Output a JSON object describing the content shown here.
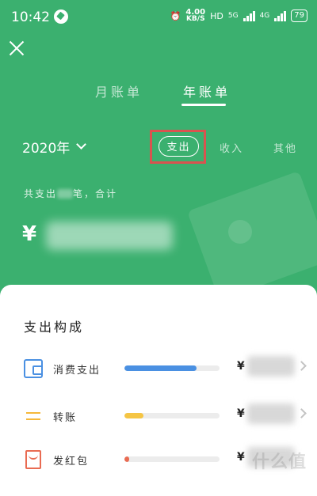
{
  "status_bar": {
    "time": "10:42",
    "speed_value": "4.00",
    "speed_unit": "KB/S",
    "hd": "HD",
    "net1": "5G",
    "net2": "4G",
    "battery": "79"
  },
  "tabs": [
    {
      "label": "月账单",
      "active": false
    },
    {
      "label": "年账单",
      "active": true
    }
  ],
  "year_select": {
    "value": "2020年"
  },
  "filters": {
    "expense": "支出",
    "income": "收入",
    "other": "其他"
  },
  "summary": {
    "prefix": "共支出",
    "suffix": "笔，合计",
    "currency": "¥"
  },
  "breakdown": {
    "title": "支出构成",
    "items": [
      {
        "label": "消费支出",
        "currency": "¥",
        "progress_fraction": 0.76,
        "color": "#4a90e2",
        "icon": "wallet-icon"
      },
      {
        "label": "转账",
        "currency": "¥",
        "progress_fraction": 0.2,
        "color": "#f5c544",
        "icon": "transfer-icon"
      },
      {
        "label": "发红包",
        "currency": "¥",
        "progress_fraction": 0.05,
        "color": "#e96b52",
        "icon": "red-packet-icon"
      }
    ]
  },
  "watermark": "什么值"
}
